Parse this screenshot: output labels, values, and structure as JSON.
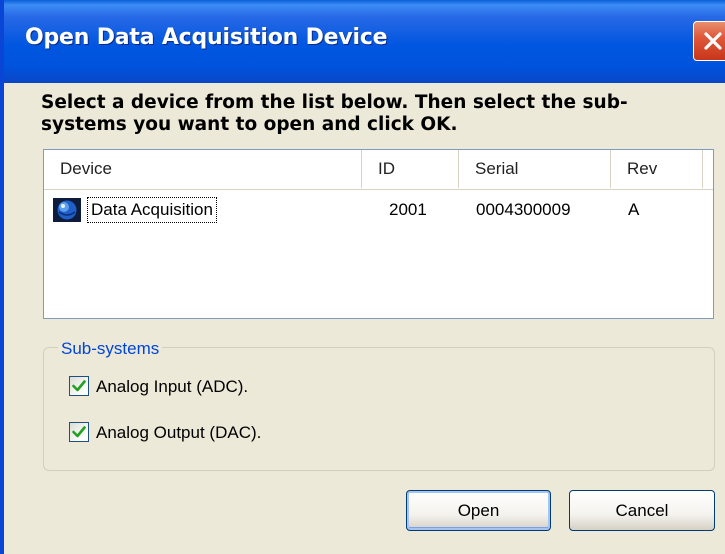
{
  "window": {
    "title": "Open Data Acquisition Device",
    "close_icon": "close-x-icon"
  },
  "instructions": "Select a device from the list below. Then select the sub-systems you want to open and click OK.",
  "device_list": {
    "columns": [
      "Device",
      "ID",
      "Serial",
      "Rev"
    ],
    "rows": [
      {
        "icon": "globe-device-icon",
        "device": "Data Acquisition",
        "id": "2001",
        "serial": "0004300009",
        "rev": "A"
      }
    ]
  },
  "subsystems": {
    "title": "Sub-systems",
    "items": [
      {
        "label": "Analog Input (ADC).",
        "checked": true
      },
      {
        "label": "Analog Output (DAC).",
        "checked": true
      }
    ]
  },
  "buttons": {
    "open": "Open",
    "cancel": "Cancel"
  },
  "colors": {
    "titlebar": "#0054e3",
    "window_face": "#ece9d8",
    "groupbox_title": "#0046d5",
    "check_mark": "#21a121"
  }
}
